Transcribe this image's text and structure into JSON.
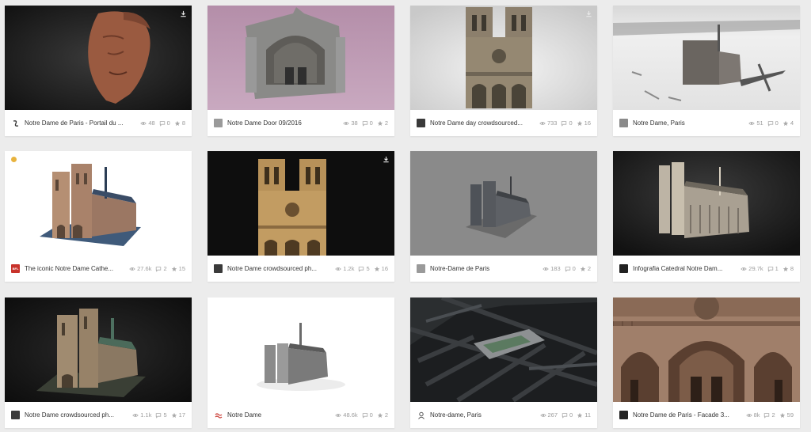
{
  "cards": [
    {
      "title": "Notre Dame de Paris - Portail du ...",
      "views": "48",
      "comments": "0",
      "likes": "8"
    },
    {
      "title": "Notre Dame Door 09/2016",
      "views": "38",
      "comments": "0",
      "likes": "2"
    },
    {
      "title": "Notre Dame day crowdsourced...",
      "views": "733",
      "comments": "0",
      "likes": "16"
    },
    {
      "title": "Notre Dame, Paris",
      "views": "51",
      "comments": "0",
      "likes": "4"
    },
    {
      "title": "The iconic Notre Dame Cathe...",
      "views": "27.6k",
      "comments": "2",
      "likes": "15"
    },
    {
      "title": "Notre Dame crowdsourced ph...",
      "views": "1.2k",
      "comments": "5",
      "likes": "16"
    },
    {
      "title": "Notre-Dame de Paris",
      "views": "183",
      "comments": "0",
      "likes": "2"
    },
    {
      "title": "Infografia Catedral Notre Dam...",
      "views": "29.7k",
      "comments": "1",
      "likes": "8"
    },
    {
      "title": "Notre Dame crowdsourced ph...",
      "views": "1.1k",
      "comments": "5",
      "likes": "17"
    },
    {
      "title": "Notre Dame",
      "views": "48.6k",
      "comments": "0",
      "likes": "2"
    },
    {
      "title": "Notre-dame, Paris",
      "views": "267",
      "comments": "0",
      "likes": "11"
    },
    {
      "title": "Notre Dame de Paris - Facade 3...",
      "views": "8k",
      "comments": "2",
      "likes": "59"
    }
  ],
  "avatars": {
    "card5_label": "BFL"
  },
  "colors": {
    "page_background": "#ececec",
    "card_background": "#ffffff",
    "stat_text": "#9b9b9b",
    "staff_pick": "#e8b33e"
  }
}
